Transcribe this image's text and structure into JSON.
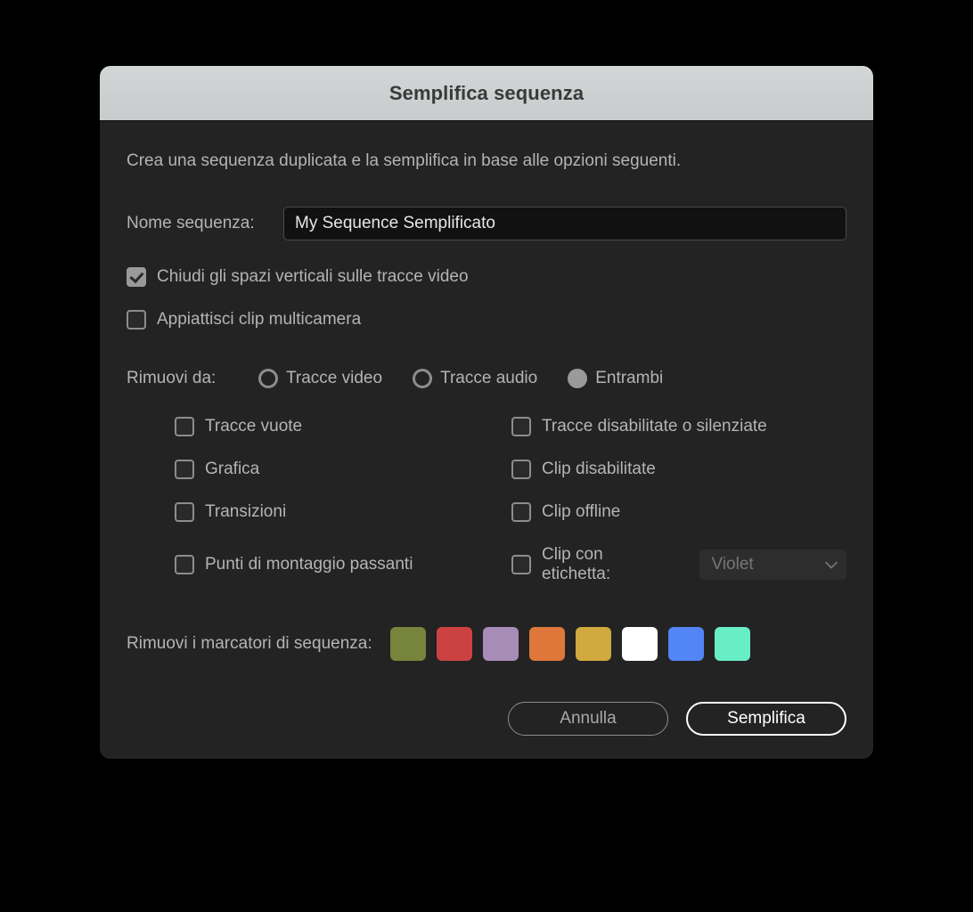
{
  "dialog": {
    "title": "Semplifica sequenza",
    "intro": "Crea una sequenza duplicata e la semplifica in base alle opzioni seguenti."
  },
  "sequence_name": {
    "label": "Nome sequenza:",
    "value": "My Sequence Semplificato",
    "placeholder": ""
  },
  "top_options": [
    {
      "label": "Chiudi gli spazi verticali sulle tracce video",
      "checked": true
    },
    {
      "label": "Appiattisci clip multicamera",
      "checked": false
    }
  ],
  "remove_from": {
    "label": "Rimuovi da:",
    "options": [
      {
        "label": "Tracce video",
        "selected": false
      },
      {
        "label": "Tracce audio",
        "selected": false
      },
      {
        "label": "Entrambi",
        "selected": true
      }
    ]
  },
  "remove_items": {
    "left": [
      {
        "label": "Tracce vuote",
        "checked": false
      },
      {
        "label": "Grafica",
        "checked": false
      },
      {
        "label": "Transizioni",
        "checked": false
      },
      {
        "label": "Punti di montaggio passanti",
        "checked": false
      }
    ],
    "right": [
      {
        "label": "Tracce disabilitate o silenziate",
        "checked": false
      },
      {
        "label": "Clip disabilitate",
        "checked": false
      },
      {
        "label": "Clip offline",
        "checked": false
      },
      {
        "label": "Clip con etichetta:",
        "checked": false
      }
    ]
  },
  "label_select": {
    "value": "Violet",
    "enabled": false,
    "chevron_icon": "chevron-down-icon"
  },
  "markers": {
    "label": "Rimuovi i marcatori di sequenza:",
    "swatches": [
      {
        "name": "olive",
        "color": "#76843c"
      },
      {
        "name": "red",
        "color": "#cc4242"
      },
      {
        "name": "violet",
        "color": "#a88cb8"
      },
      {
        "name": "orange",
        "color": "#e0773a"
      },
      {
        "name": "gold",
        "color": "#d0a93f"
      },
      {
        "name": "white",
        "color": "#ffffff"
      },
      {
        "name": "blue",
        "color": "#5285f5"
      },
      {
        "name": "mint",
        "color": "#68eec4"
      }
    ]
  },
  "footer": {
    "cancel_label": "Annulla",
    "confirm_label": "Semplifica"
  },
  "colors": {
    "dialog_bg": "#232323",
    "titlebar_bg": "#ccd0d0",
    "text": "#b4b4b4",
    "accent": "#ffffff"
  }
}
